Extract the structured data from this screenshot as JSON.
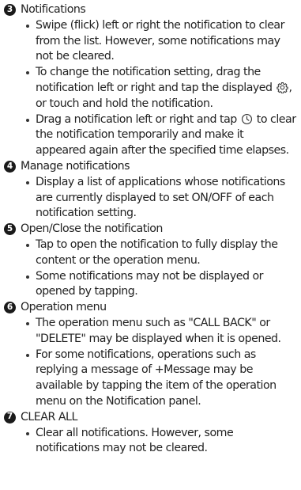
{
  "sections": [
    {
      "number": "3",
      "title": "Notifications",
      "items": [
        {
          "text": "Swipe (flick) left or right the notification to clear from the list. However, some notifications may not be cleared."
        },
        {
          "before": "To change the notification setting, drag the notification left or right and tap the displayed ",
          "icon": "gear-icon",
          "after": ", or touch and hold the notification."
        },
        {
          "before": "Drag a notification left or right and tap ",
          "icon": "clock-icon",
          "after": " to clear the notification temporarily and make it appeared again after the specified time elapses."
        }
      ]
    },
    {
      "number": "4",
      "title": "Manage notifications",
      "items": [
        {
          "text": "Display a list of applications whose notifications are currently displayed to set ON/OFF of each notification setting."
        }
      ]
    },
    {
      "number": "5",
      "title": "Open/Close the notification",
      "items": [
        {
          "text": "Tap to open the notification to fully display the content or the operation menu."
        },
        {
          "text": "Some notifications may not be displayed or opened by tapping."
        }
      ]
    },
    {
      "number": "6",
      "title": "Operation menu",
      "items": [
        {
          "text": "The operation menu such as \"CALL BACK\" or \"DELETE\" may be displayed when it is opened."
        },
        {
          "text": "For some notifications, operations such as replying a message of +Message may be available by tapping the item of the operation menu on the Notification panel."
        }
      ]
    },
    {
      "number": "7",
      "title": "CLEAR ALL",
      "items": [
        {
          "text": "Clear all notifications. However, some notifications may not be cleared."
        }
      ]
    }
  ]
}
